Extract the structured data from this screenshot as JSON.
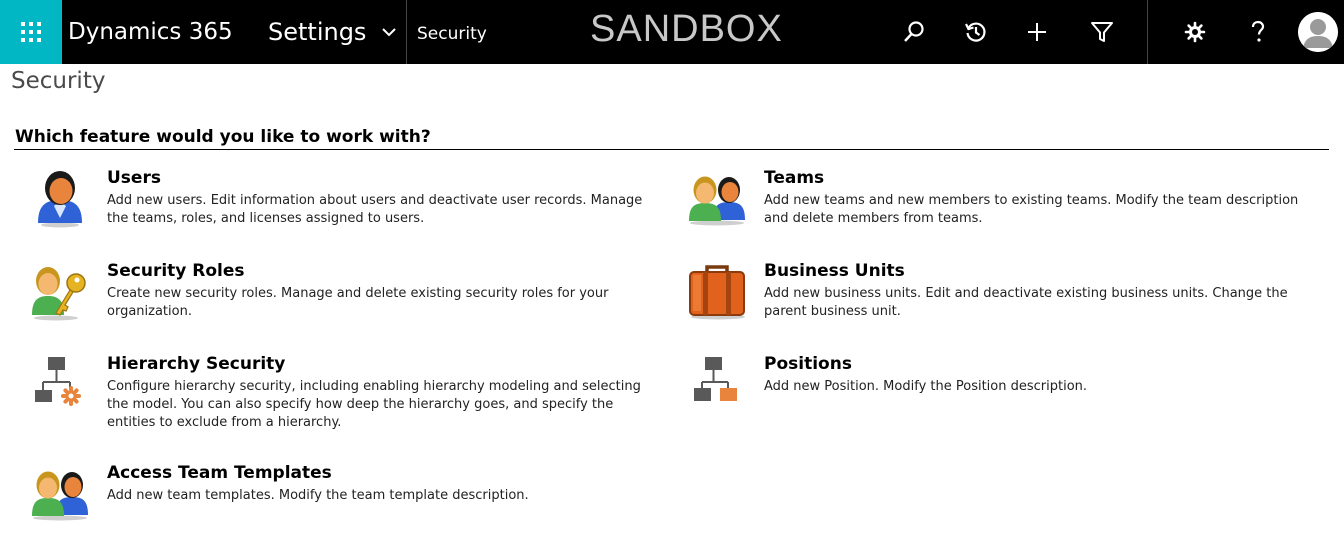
{
  "topbar": {
    "app_name": "Dynamics 365",
    "area_label": "Settings",
    "breadcrumb": "Security",
    "environment_label": "SANDBOX",
    "icons": [
      "app-launcher-icon",
      "chevron-down-icon",
      "search-icon",
      "recent-history-icon",
      "plus-icon",
      "filter-icon",
      "gear-icon",
      "help-icon",
      "user-avatar-icon"
    ],
    "brand_color": "#00b7c3"
  },
  "page": {
    "title": "Security",
    "question": "Which feature would you like to work with?"
  },
  "features": [
    {
      "title": "Users",
      "description": "Add new users. Edit information about users and deactivate user records. Manage the teams, roles, and licenses assigned to users.",
      "icon": "user-icon"
    },
    {
      "title": "Teams",
      "description": "Add new teams and new members to existing teams. Modify the team description and delete members from teams.",
      "icon": "team-icon"
    },
    {
      "title": "Security Roles",
      "description": "Create new security roles. Manage and delete existing security roles for your organization.",
      "icon": "user-key-icon"
    },
    {
      "title": "Business Units",
      "description": "Add new business units. Edit and deactivate existing business units. Change the parent business unit.",
      "icon": "briefcase-icon"
    },
    {
      "title": "Hierarchy Security",
      "description": "Configure hierarchy security, including enabling hierarchy modeling and selecting the model. You can also specify how deep the hierarchy goes, and specify the entities to exclude from a hierarchy.",
      "icon": "hierarchy-gear-icon"
    },
    {
      "title": "Positions",
      "description": "Add new Position. Modify the Position description.",
      "icon": "hierarchy-position-icon"
    },
    {
      "title": "Access Team Templates",
      "description": "Add new team templates. Modify the team template description.",
      "icon": "team-template-icon"
    }
  ]
}
